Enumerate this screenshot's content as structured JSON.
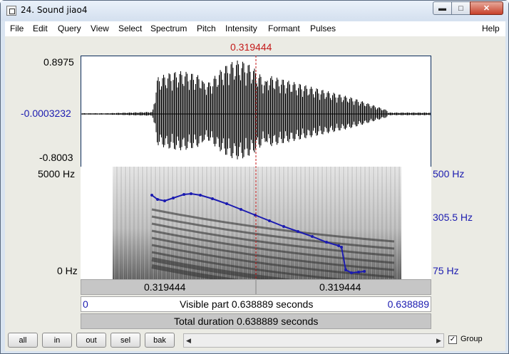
{
  "window": {
    "title": "24. Sound jiao4"
  },
  "menu": [
    "File",
    "Edit",
    "Query",
    "View",
    "Select",
    "Spectrum",
    "Pitch",
    "Intensity",
    "Formant",
    "Pulses",
    "Help"
  ],
  "cursor_time": "0.319444",
  "waveform": {
    "ymax_label": "0.8975",
    "ymid_label": "-0.0003232",
    "ymin_label": "-0.8003"
  },
  "spectrogram": {
    "freq_max_label": "5000 Hz",
    "freq_min_label": "0 Hz",
    "pitch_max_label": "500 Hz",
    "pitch_mid_label": "305.5 Hz",
    "pitch_min_label": "75 Hz"
  },
  "time_bar": {
    "left": "0.319444",
    "right": "0.319444"
  },
  "visible_bar": {
    "start": "0",
    "text": "Visible part 0.638889 seconds",
    "end": "0.638889"
  },
  "total_bar": {
    "text": "Total duration 0.638889 seconds"
  },
  "buttons": {
    "all": "all",
    "in": "in",
    "out": "out",
    "sel": "sel",
    "bak": "bak"
  },
  "group": {
    "label": "Group",
    "checked": true,
    "mark": "✓"
  },
  "colors": {
    "cursor": "#c41a1a",
    "pitch": "#1b1bb0",
    "axis_blue": "#1b1bb0"
  }
}
